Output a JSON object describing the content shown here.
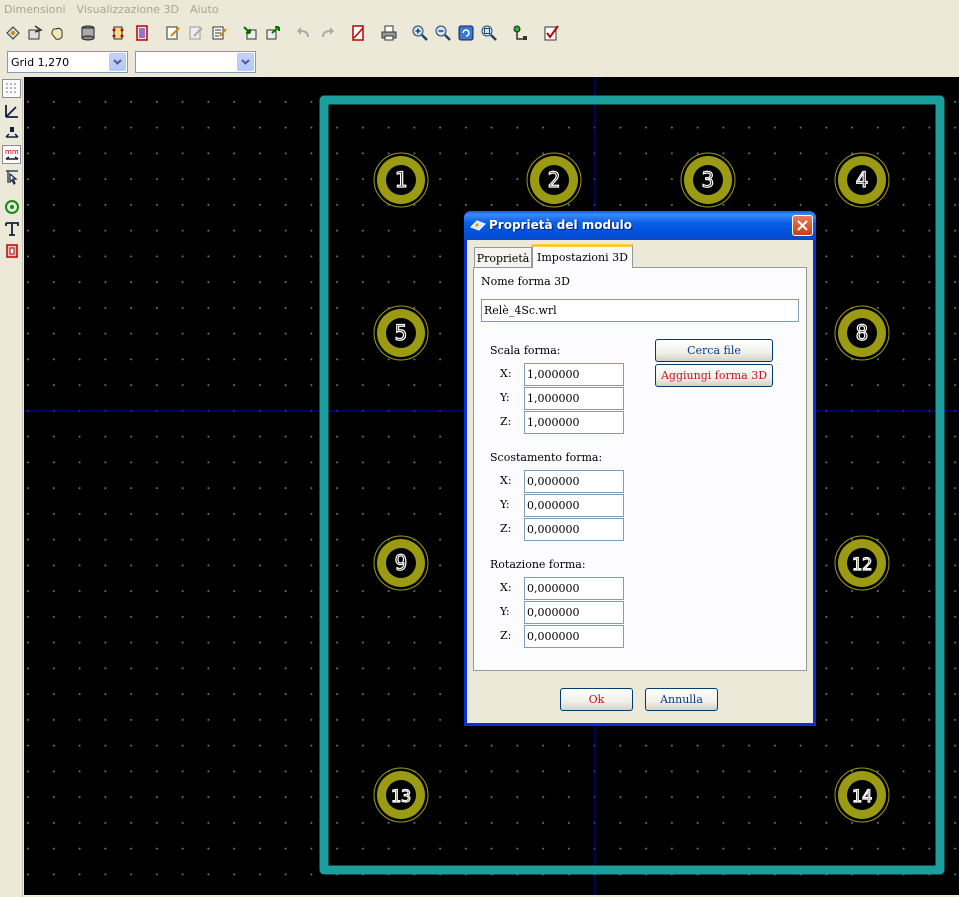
{
  "menu": [
    "Dimensioni",
    "Visualizzazione 3D",
    "Aiuto"
  ],
  "toolbar_icons": [
    "footprint-lib-icon",
    "load-module-icon",
    "hand-icon",
    "db-icon",
    "module-icon",
    "module-outline-icon",
    "edit-icon",
    "edit-disabled-icon",
    "edit-props-icon",
    "save-module-icon",
    "export-module-icon",
    "undo-icon",
    "redo-icon",
    "module-check-icon",
    "print-icon",
    "zoom-in-icon",
    "zoom-out-icon",
    "redraw-icon",
    "zoom-fit-icon",
    "tree-icon",
    "check-icon"
  ],
  "grid_select": {
    "value": "Grid 1,270",
    "zoom_value": ""
  },
  "left_toolbar_icons": [
    "grid-toggle-icon",
    "polar-coord-icon",
    "units-inch-icon",
    "units-mm-icon",
    "cursor-shape-icon",
    "pad-icon",
    "text-icon",
    "module-outline-icon"
  ],
  "pcb": {
    "pads": [
      "1",
      "2",
      "3",
      "4",
      "5",
      "8",
      "9",
      "12",
      "13",
      "14"
    ],
    "colors": {
      "background": "#000000",
      "outline": "#1a9e9e",
      "pad": "#9b9b13",
      "axis": "#0000c8"
    }
  },
  "dialog": {
    "title": "Proprietà del modulo",
    "tabs": [
      "Proprietà",
      "Impostazioni 3D"
    ],
    "active_tab": "Impostazioni 3D",
    "shape_name_label": "Nome forma 3D",
    "shape_name_value": "Relè_4Sc.wrl",
    "browse_button": "Cerca file",
    "add_shape_button": "Aggiungi forma 3D",
    "scale": {
      "label": "Scala forma:",
      "x": "1,000000",
      "y": "1,000000",
      "z": "1,000000"
    },
    "offset": {
      "label": "Scostamento forma:",
      "x": "0,000000",
      "y": "0,000000",
      "z": "0,000000"
    },
    "rotation": {
      "label": "Rotazione forma:",
      "x": "0,000000",
      "y": "0,000000",
      "z": "0,000000"
    },
    "axis_labels": {
      "x": "X:",
      "y": "Y:",
      "z": "Z:"
    },
    "ok_button": "Ok",
    "cancel_button": "Annulla"
  }
}
